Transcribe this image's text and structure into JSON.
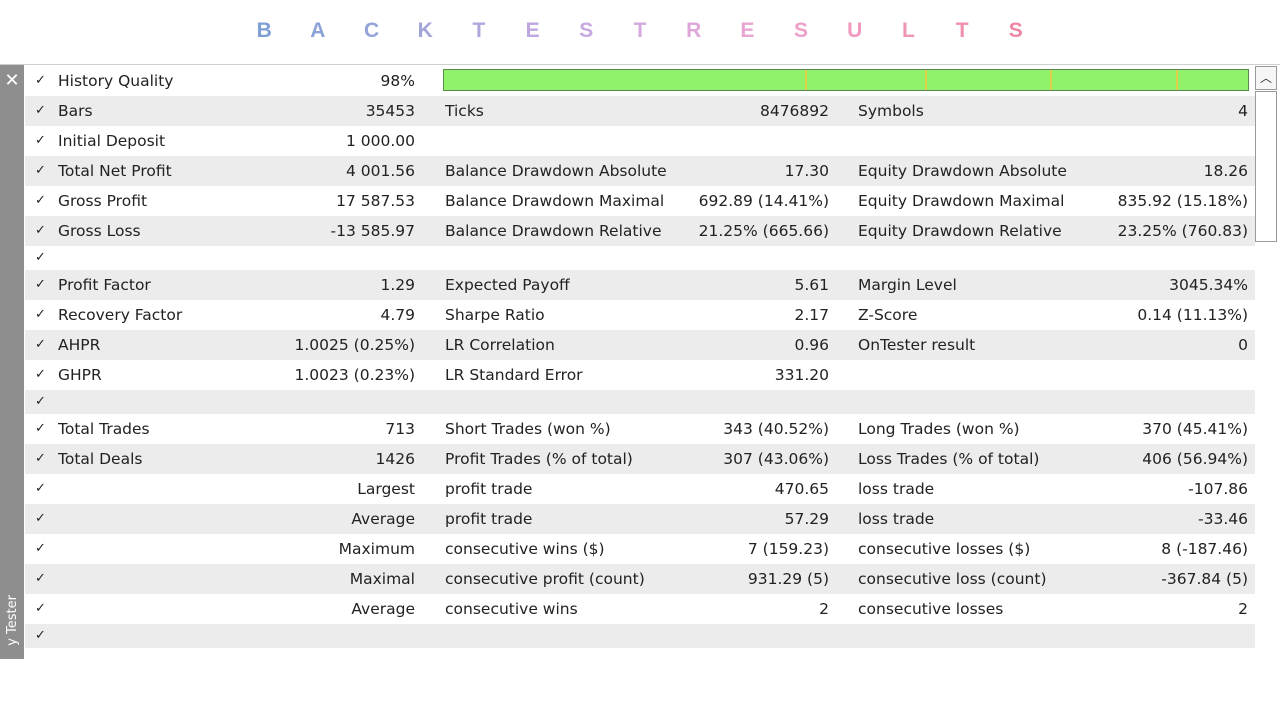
{
  "title": {
    "letters": [
      "B",
      "A",
      "C",
      "K",
      "T",
      "E",
      "S",
      "T",
      "R",
      "E",
      "S",
      "U",
      "L",
      "T",
      "S"
    ],
    "colors": [
      "#7f9fd4",
      "#8aa2d6",
      "#95a3d8",
      "#a2a4da",
      "#b0a6dc",
      "#bda7de",
      "#c9a8df",
      "#d5a8de",
      "#dfa7d9",
      "#e7a5d2",
      "#ec9fc9",
      "#ef9abf",
      "#f094b5",
      "#f08eab",
      "#ef86a1"
    ]
  },
  "panel": {
    "close_icon": "close-icon",
    "side_tab_label": "y Tester",
    "scroll_up_icon": "chevron-up-icon"
  },
  "colors": {
    "shaded_row": "#ececec",
    "quality_bar": "#8ff26a",
    "side_panel": "#8e8e8e"
  },
  "rows": [
    {
      "shade": "white",
      "c1": "History Quality",
      "v1": "98%",
      "quality_bar": true,
      "quality_value": 0.98
    },
    {
      "shade": "shaded",
      "c1": "Bars",
      "v1": "35453",
      "c2": "Ticks",
      "v2": "8476892",
      "c3": "Symbols",
      "v3": "4"
    },
    {
      "shade": "white",
      "c1": "Initial Deposit",
      "v1": "1 000.00"
    },
    {
      "shade": "shaded",
      "c1": "Total Net Profit",
      "v1": "4 001.56",
      "c2": "Balance Drawdown Absolute",
      "v2": "17.30",
      "c3": "Equity Drawdown Absolute",
      "v3": "18.26"
    },
    {
      "shade": "white",
      "c1": "Gross Profit",
      "v1": "17 587.53",
      "c2": "Balance Drawdown Maximal",
      "v2": "692.89 (14.41%)",
      "c3": "Equity Drawdown Maximal",
      "v3": "835.92 (15.18%)"
    },
    {
      "shade": "shaded",
      "c1": "Gross Loss",
      "v1": "-13 585.97",
      "c2": "Balance Drawdown Relative",
      "v2": "21.25% (665.66)",
      "c3": "Equity Drawdown Relative",
      "v3": "23.25% (760.83)"
    },
    {
      "shade": "white",
      "short": true
    },
    {
      "shade": "shaded",
      "c1": "Profit Factor",
      "v1": "1.29",
      "c2": "Expected Payoff",
      "v2": "5.61",
      "c3": "Margin Level",
      "v3": "3045.34%"
    },
    {
      "shade": "white",
      "c1": "Recovery Factor",
      "v1": "4.79",
      "c2": "Sharpe Ratio",
      "v2": "2.17",
      "c3": "Z-Score",
      "v3": "0.14 (11.13%)"
    },
    {
      "shade": "shaded",
      "c1": "AHPR",
      "v1": "1.0025 (0.25%)",
      "c2": "LR Correlation",
      "v2": "0.96",
      "c3": "OnTester result",
      "v3": "0"
    },
    {
      "shade": "white",
      "c1": "GHPR",
      "v1": "1.0023 (0.23%)",
      "c2": "LR Standard Error",
      "v2": "331.20"
    },
    {
      "shade": "shaded",
      "short": true
    },
    {
      "shade": "white",
      "c1": "Total Trades",
      "v1": "713",
      "c2": "Short Trades (won %)",
      "v2": "343 (40.52%)",
      "c3": "Long Trades (won %)",
      "v3": "370 (45.41%)"
    },
    {
      "shade": "shaded",
      "c1": "Total Deals",
      "v1": "1426",
      "c2": "Profit Trades (% of total)",
      "v2": "307 (43.06%)",
      "c3": "Loss Trades (% of total)",
      "v3": "406 (56.94%)"
    },
    {
      "shade": "white",
      "v1": "Largest",
      "c2": "profit trade",
      "v2": "470.65",
      "c3": "loss trade",
      "v3": "-107.86"
    },
    {
      "shade": "shaded",
      "v1": "Average",
      "c2": "profit trade",
      "v2": "57.29",
      "c3": "loss trade",
      "v3": "-33.46"
    },
    {
      "shade": "white",
      "v1": "Maximum",
      "c2": "consecutive wins ($)",
      "v2": "7 (159.23)",
      "c3": "consecutive losses ($)",
      "v3": "8 (-187.46)"
    },
    {
      "shade": "shaded",
      "v1": "Maximal",
      "c2": "consecutive profit (count)",
      "v2": "931.29 (5)",
      "c3": "consecutive loss (count)",
      "v3": "-367.84 (5)"
    },
    {
      "shade": "white",
      "v1": "Average",
      "c2": "consecutive wins",
      "v2": "2",
      "c3": "consecutive losses",
      "v3": "2"
    },
    {
      "shade": "shaded",
      "short": true
    }
  ]
}
